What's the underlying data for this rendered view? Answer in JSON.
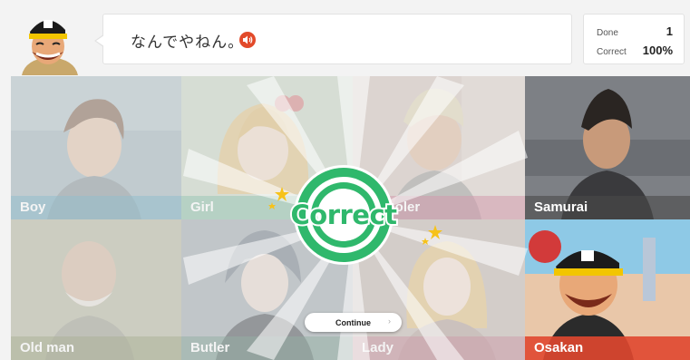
{
  "phrase": {
    "text": "なんでやねん。",
    "audio_icon": "speaker-icon"
  },
  "stats": {
    "done_label": "Done",
    "done_value": "1",
    "correct_label": "Correct",
    "correct_value": "100%"
  },
  "cards": [
    {
      "label": "Boy",
      "color": "#2b88a8"
    },
    {
      "label": "Girl",
      "color": "#3a9a7a"
    },
    {
      "label": "Schooler",
      "color": "#b43a63"
    },
    {
      "label": "Samurai",
      "color": "#4a4a4a"
    },
    {
      "label": "Old man",
      "color": "#5b6a2e"
    },
    {
      "label": "Butler",
      "color": "#2a6a4e"
    },
    {
      "label": "Lady",
      "color": "#a83a5a"
    },
    {
      "label": "Osakan",
      "color": "#e0472f"
    }
  ],
  "result": {
    "text": "Correct",
    "color": "#2fb86c"
  },
  "continue_button": {
    "label": "Continue",
    "icon": "chevron-right-icon"
  }
}
